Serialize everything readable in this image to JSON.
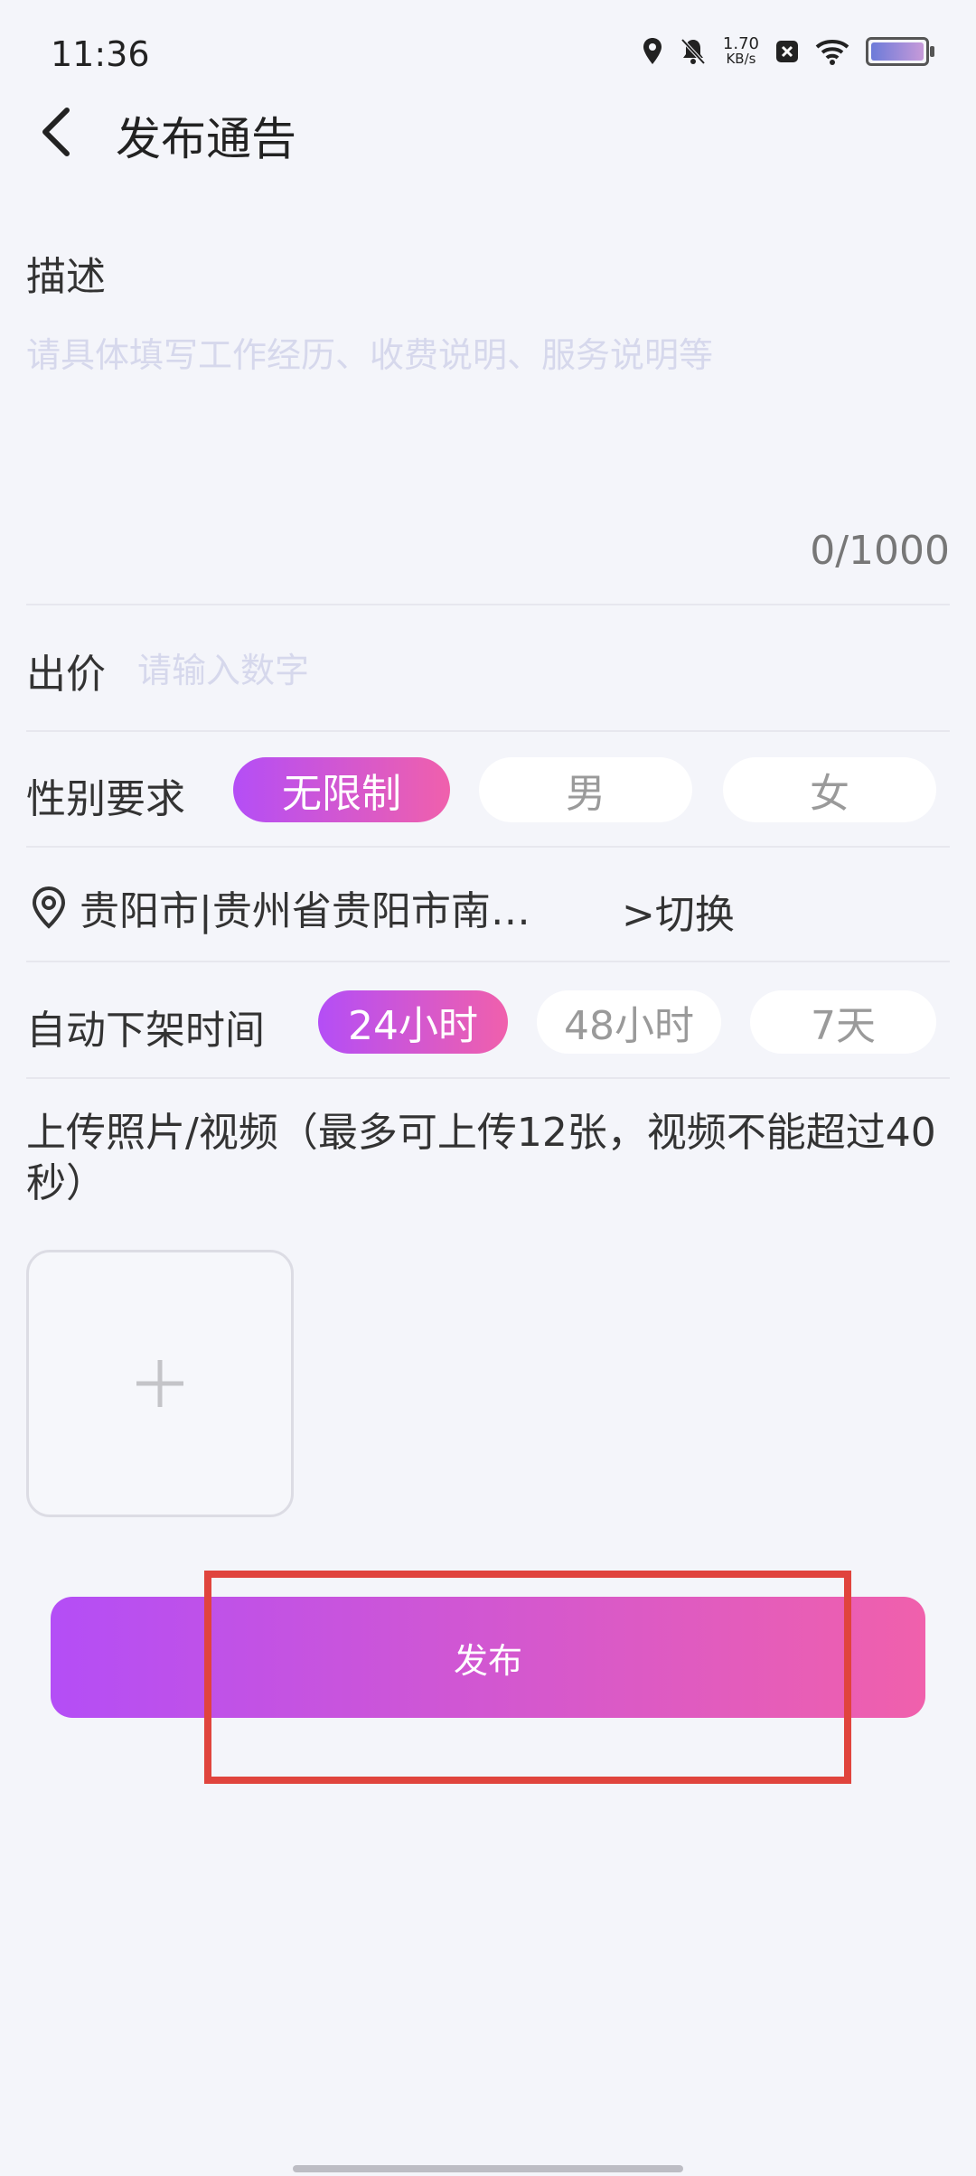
{
  "status_bar": {
    "time": "11:36",
    "net_speed_value": "1.70",
    "net_speed_unit": "KB/s"
  },
  "header": {
    "title": "发布通告"
  },
  "description": {
    "label": "描述",
    "placeholder": "请具体填写工作经历、收费说明、服务说明等",
    "char_count": "0/1000"
  },
  "price": {
    "label": "出价",
    "placeholder": "请输入数字"
  },
  "gender": {
    "label": "性别要求",
    "options": [
      {
        "label": "无限制",
        "selected": true
      },
      {
        "label": "男",
        "selected": false
      },
      {
        "label": "女",
        "selected": false
      }
    ]
  },
  "location": {
    "text": "贵阳市|贵州省贵阳市南…",
    "switch_label": ">切换"
  },
  "auto_offline": {
    "label": "自动下架时间",
    "options": [
      {
        "label": "24小时",
        "selected": true
      },
      {
        "label": "48小时",
        "selected": false
      },
      {
        "label": "7天",
        "selected": false
      }
    ]
  },
  "upload": {
    "title": "上传照片/视频（最多可上传12张，视频不能超过40秒）"
  },
  "publish": {
    "label": "发布"
  },
  "colors": {
    "accent_start": "#b44ef6",
    "accent_end": "#f060ac",
    "highlight": "#e0443d"
  }
}
